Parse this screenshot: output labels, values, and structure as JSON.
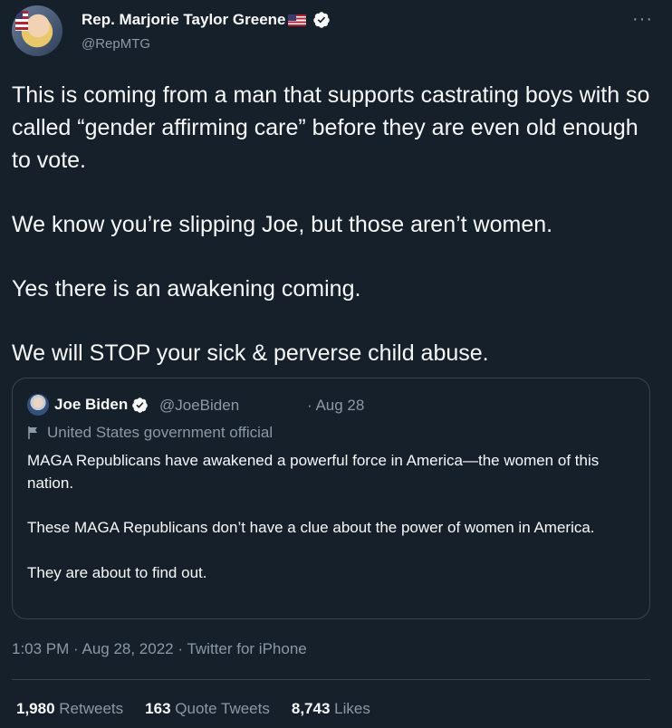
{
  "author": {
    "display_name": "Rep. Marjorie Taylor Greene",
    "handle": "@RepMTG",
    "flag_icon": "us-flag-icon",
    "verified_icon": "verified-badge-icon"
  },
  "more_label": "···",
  "tweet": {
    "paragraphs": [
      "This is coming from a man that supports castrating boys with so called “gender affirming care” before they are even old enough to vote.",
      "We know you’re slipping Joe, but those aren’t women.",
      "Yes there is an awakening coming.",
      "We will STOP your sick & perverse child abuse."
    ]
  },
  "quoted": {
    "display_name": "Joe Biden",
    "handle": "@JoeBiden",
    "date": "· Aug 28",
    "label": "United States government official",
    "paragraphs": [
      "MAGA Republicans have awakened a powerful force in America—the women of this nation.",
      "These MAGA Republicans don’t have a clue about the power of women in America.",
      "They are about to find out."
    ]
  },
  "meta": {
    "time": "1:03 PM",
    "date": "Aug 28, 2022",
    "source": "Twitter for iPhone",
    "separator": " · "
  },
  "stats": {
    "retweets_count": "1,980",
    "retweets_label": "Retweets",
    "quotes_count": "163",
    "quotes_label": "Quote Tweets",
    "likes_count": "8,743",
    "likes_label": "Likes"
  },
  "colors": {
    "background": "#15202b",
    "text": "#f7f9f9",
    "secondary": "#8b98a5",
    "border": "#38444d"
  }
}
